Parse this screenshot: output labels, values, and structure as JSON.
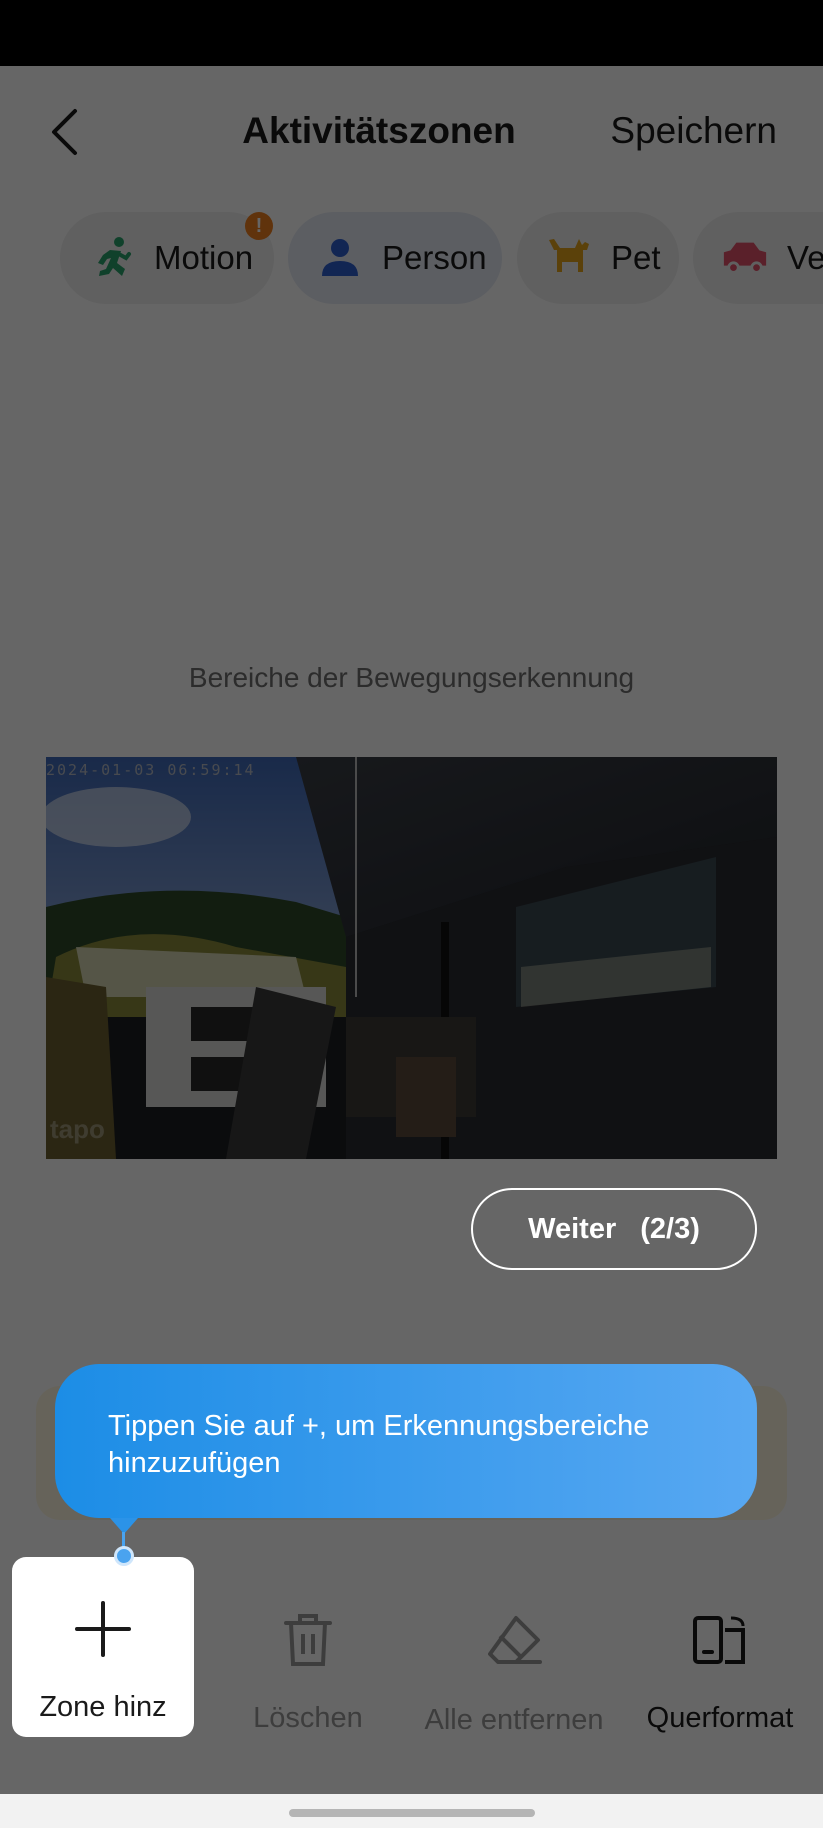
{
  "header": {
    "title": "Aktivitätszonen",
    "save_label": "Speichern"
  },
  "chips": [
    {
      "label": "Motion",
      "icon": "running-person-icon",
      "color": "#2aa36b",
      "warning": "!"
    },
    {
      "label": "Person",
      "icon": "person-icon",
      "color": "#2f5fd0"
    },
    {
      "label": "Pet",
      "icon": "dog-icon",
      "color": "#e3a21a"
    },
    {
      "label": "Ve",
      "icon": "car-icon",
      "color": "#e2526a"
    }
  ],
  "main": {
    "detection_label": "Bereiche der Bewegungserkennung",
    "camera_timestamp": "2024-01-03  06:59:14",
    "camera_logo": "tapo"
  },
  "tour": {
    "next_label": "Weiter",
    "progress": "(2/3)",
    "tooltip_text": "Tippen Sie auf +, um Erkennungsbereiche hinzuzufügen"
  },
  "toolbar": {
    "add_label": "Zone hinz",
    "delete_label": "Löschen",
    "clear_all_label": "Alle entfernen",
    "landscape_label": "Querformat"
  },
  "colors": {
    "tooltip_start": "#1c8de6",
    "tooltip_end": "#58a8f2",
    "warning": "#f07f1f"
  }
}
